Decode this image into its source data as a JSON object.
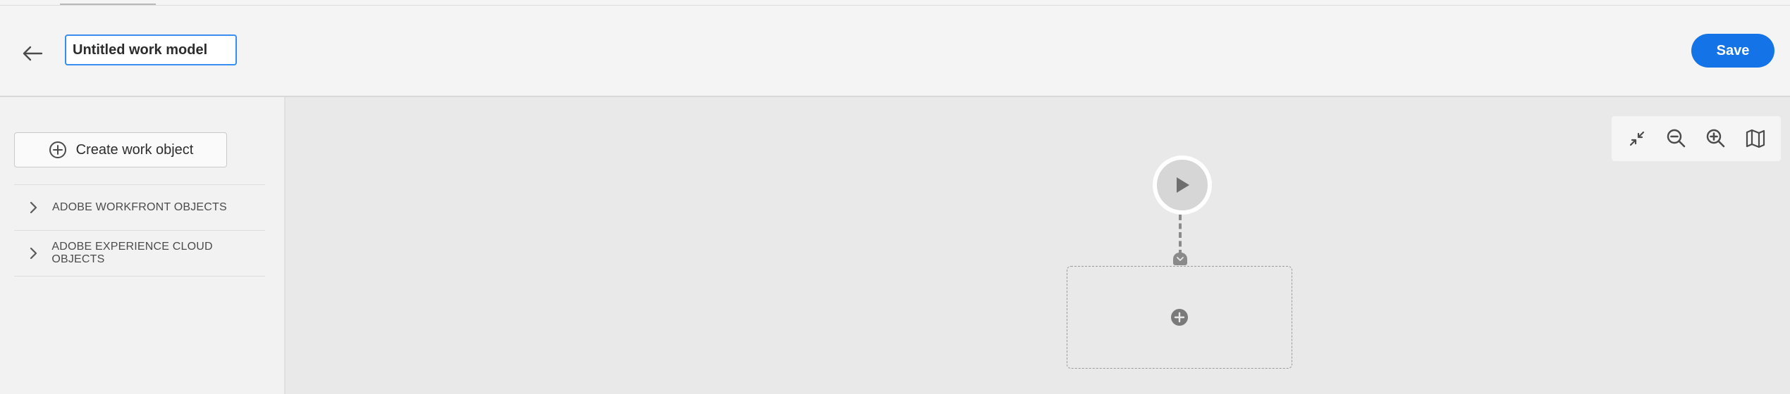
{
  "header": {
    "back_icon": "arrow-left-icon",
    "title_value": "Untitled work model",
    "save_label": "Save",
    "accent_color": "#1473e6"
  },
  "sidebar": {
    "create_button_label": "Create work object",
    "create_icon": "add-circle-icon",
    "sections": [
      {
        "label": "ADOBE WORKFRONT OBJECTS",
        "icon": "chevron-right-icon"
      },
      {
        "label": "ADOBE EXPERIENCE CLOUD OBJECTS",
        "icon": "chevron-right-icon"
      }
    ]
  },
  "canvas": {
    "tools": [
      {
        "name": "collapse-icon"
      },
      {
        "name": "zoom-out-icon"
      },
      {
        "name": "zoom-in-icon"
      },
      {
        "name": "map-icon"
      }
    ],
    "start_node_icon": "play-icon",
    "add_node_icon": "add-circle-icon"
  }
}
